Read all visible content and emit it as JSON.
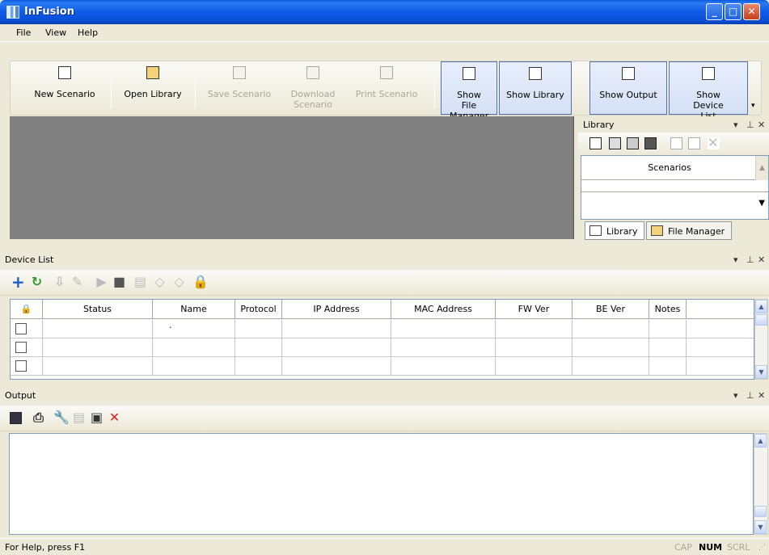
{
  "window": {
    "title": "InFusion"
  },
  "menu": [
    "File",
    "View",
    "Help"
  ],
  "toolbar": {
    "buttons": [
      {
        "label": "New Scenario",
        "enabled": true
      },
      {
        "label": "Open Library",
        "enabled": true
      },
      {
        "label": "Save Scenario",
        "enabled": false
      },
      {
        "label": "Download Scenario",
        "enabled": false
      },
      {
        "label": "Print Scenario",
        "enabled": false
      },
      {
        "label": "Show File Manager",
        "enabled": true,
        "checked": true
      },
      {
        "label": "Show Library",
        "enabled": true,
        "checked": true
      },
      {
        "label": "Show Output",
        "enabled": true,
        "checked": true
      },
      {
        "label": "Show Device List",
        "enabled": true,
        "checked": true
      }
    ]
  },
  "library": {
    "title": "Library",
    "header": "Scenarios",
    "tabs": [
      "Library",
      "File Manager"
    ]
  },
  "device_list": {
    "title": "Device List",
    "columns": [
      "Status",
      "Name",
      "Protocol",
      "IP Address",
      "MAC Address",
      "FW Ver",
      "BE Ver",
      "Notes"
    ],
    "rows": [
      {
        "name": "."
      },
      {
        "name": ""
      },
      {
        "name": ""
      }
    ]
  },
  "output": {
    "title": "Output"
  },
  "status": {
    "help": "For Help, press F1",
    "indicators": [
      {
        "label": "CAP",
        "active": false
      },
      {
        "label": "NUM",
        "active": true
      },
      {
        "label": "SCRL",
        "active": false
      }
    ]
  }
}
